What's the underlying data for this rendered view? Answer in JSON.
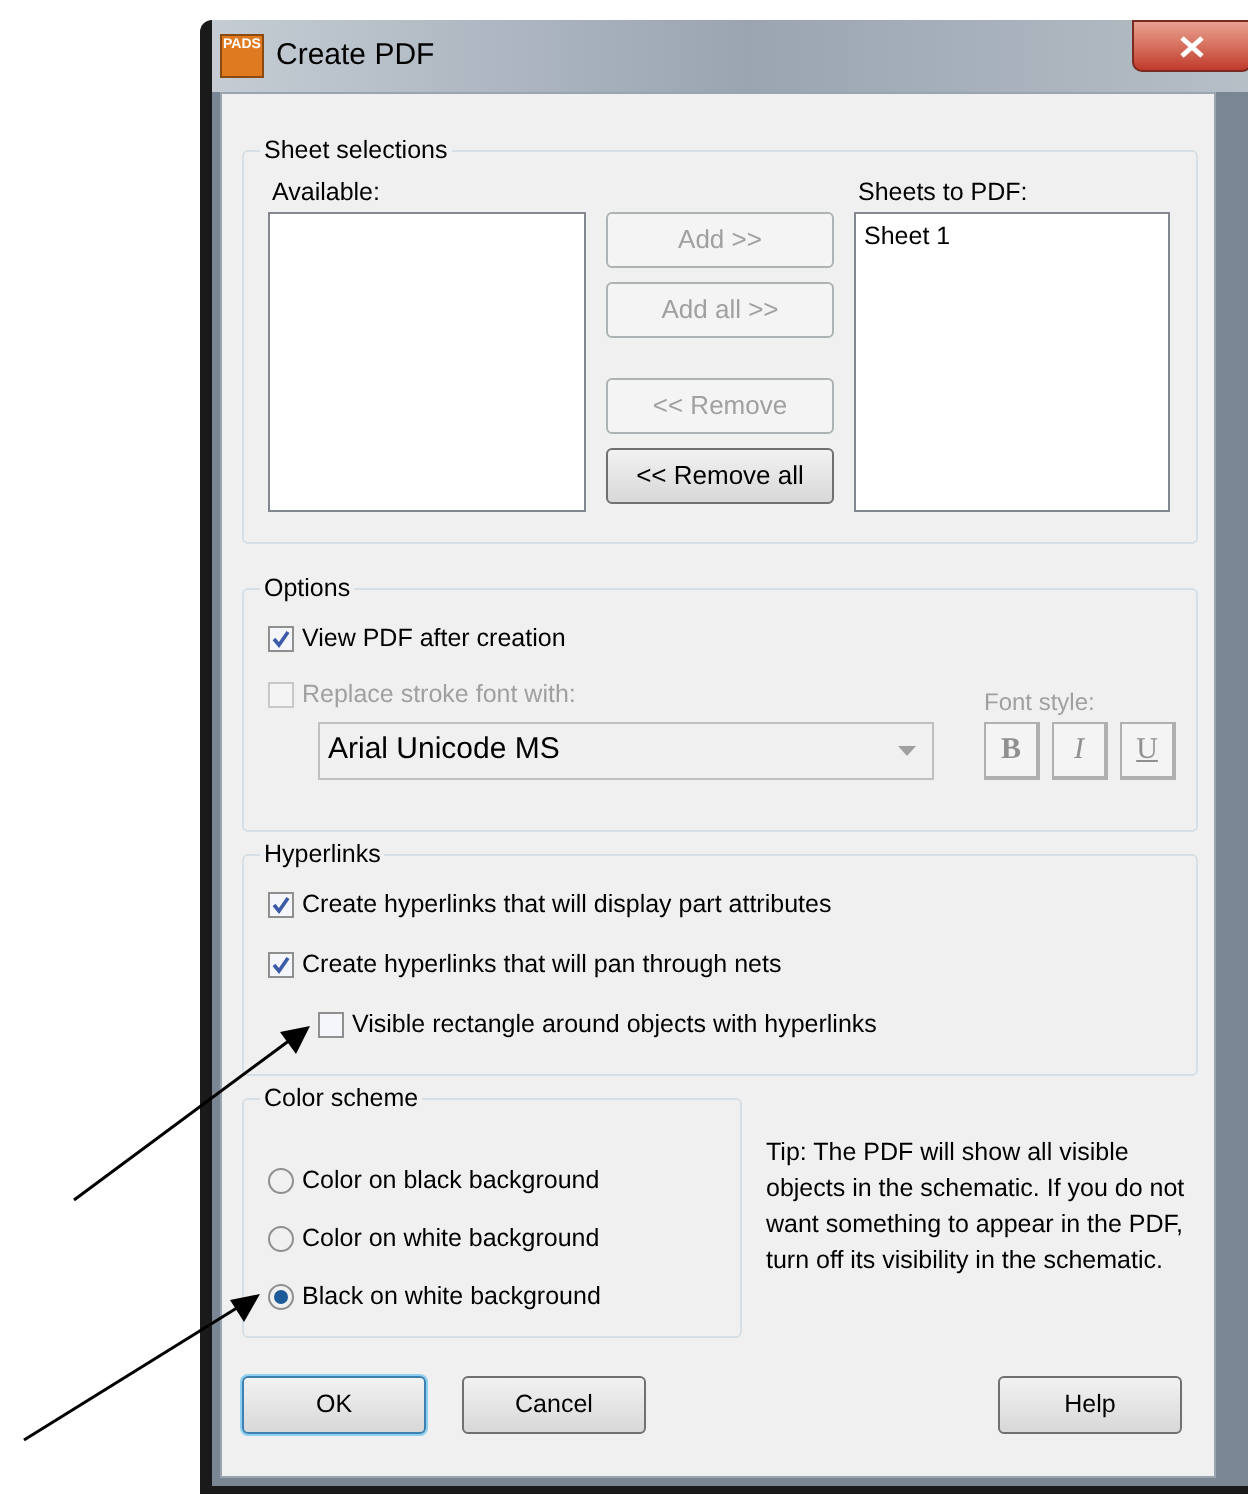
{
  "window": {
    "title": "Create PDF",
    "app_icon_text": "PADS"
  },
  "sheet_selections": {
    "title": "Sheet selections",
    "available_label": "Available:",
    "sheets_label": "Sheets to PDF:",
    "sheets_items": [
      "Sheet 1"
    ],
    "buttons": [
      {
        "label": "Add >>",
        "disabled": true
      },
      {
        "label": "Add all >>",
        "disabled": true
      },
      {
        "label": "<< Remove",
        "disabled": true
      },
      {
        "label": "<< Remove all",
        "disabled": false
      }
    ]
  },
  "options": {
    "title": "Options",
    "view_pdf": {
      "label": "View PDF after creation",
      "checked": true,
      "disabled": false
    },
    "replace_font": {
      "label": "Replace stroke font with:",
      "checked": false,
      "disabled": true
    },
    "font_select": {
      "value": "Arial Unicode MS",
      "disabled": true
    },
    "font_style_label": "Font style:",
    "style_buttons": [
      {
        "label": "B",
        "kind": "bold"
      },
      {
        "label": "I",
        "kind": "italic"
      },
      {
        "label": "U",
        "kind": "underline"
      }
    ]
  },
  "hyperlinks": {
    "title": "Hyperlinks",
    "items": [
      {
        "label": "Create hyperlinks that will display part attributes",
        "checked": true,
        "indented": false
      },
      {
        "label": "Create hyperlinks that will pan through nets",
        "checked": true,
        "indented": false
      },
      {
        "label": "Visible rectangle around objects with hyperlinks",
        "checked": false,
        "indented": true
      }
    ]
  },
  "color_scheme": {
    "title": "Color scheme",
    "options": [
      {
        "label": "Color on black background",
        "selected": false
      },
      {
        "label": "Color on white background",
        "selected": false
      },
      {
        "label": "Black on white background",
        "selected": true
      }
    ]
  },
  "tip": "Tip: The PDF will show all visible objects in the schematic. If you do not want something to appear in the PDF, turn off its visibility in the schematic.",
  "footer_buttons": [
    {
      "label": "OK",
      "default": true
    },
    {
      "label": "Cancel",
      "default": false
    },
    {
      "label": "Help",
      "default": false
    }
  ]
}
